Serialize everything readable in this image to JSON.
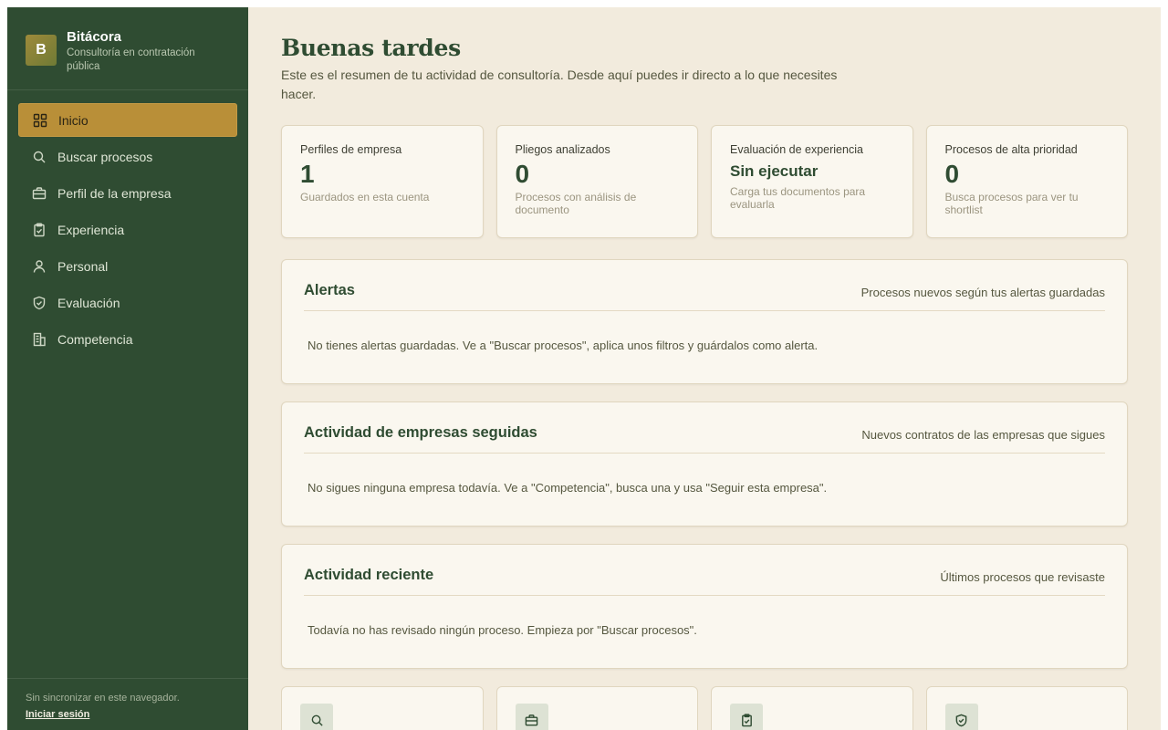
{
  "brand": {
    "initial": "B",
    "name": "Bitácora",
    "subtitle": "Consultoría en contratación pública"
  },
  "nav": {
    "items": [
      {
        "label": "Inicio",
        "icon": "grid-icon",
        "active": true
      },
      {
        "label": "Buscar procesos",
        "icon": "search-icon"
      },
      {
        "label": "Perfil de la empresa",
        "icon": "briefcase-icon"
      },
      {
        "label": "Experiencia",
        "icon": "clipboard-check-icon"
      },
      {
        "label": "Personal",
        "icon": "user-icon"
      },
      {
        "label": "Evaluación",
        "icon": "shield-check-icon"
      },
      {
        "label": "Competencia",
        "icon": "building-icon"
      }
    ]
  },
  "footer": {
    "sync_text": "Sin sincronizar en este navegador.",
    "login_label": "Iniciar sesión"
  },
  "header": {
    "greeting": "Buenas tardes",
    "intro": "Este es el resumen de tu actividad de consultoría. Desde aquí puedes ir directo a lo que necesites hacer."
  },
  "stats": [
    {
      "label": "Perfiles de empresa",
      "value": "1",
      "note": "Guardados en esta cuenta"
    },
    {
      "label": "Pliegos analizados",
      "value": "0",
      "note": "Procesos con análisis de documento"
    },
    {
      "label": "Evaluación de experiencia",
      "value": "Sin ejecutar",
      "note": "Carga tus documentos para evaluarla"
    },
    {
      "label": "Procesos de alta prioridad",
      "value": "0",
      "note": "Busca procesos para ver tu shortlist"
    }
  ],
  "panels": {
    "alerts": {
      "title": "Alertas",
      "subtitle": "Procesos nuevos según tus alertas guardadas",
      "body": "No tienes alertas guardadas. Ve a \"Buscar procesos\", aplica unos filtros y guárdalos como alerta."
    },
    "followed": {
      "title": "Actividad de empresas seguidas",
      "subtitle": "Nuevos contratos de las empresas que sigues",
      "body": "No sigues ninguna empresa todavía. Ve a \"Competencia\", busca una y usa \"Seguir esta empresa\"."
    },
    "recent": {
      "title": "Actividad reciente",
      "subtitle": "Últimos procesos que revisaste",
      "body": "Todavía no has revisado ningún proceso. Empieza por \"Buscar procesos\"."
    }
  },
  "quick_cards": [
    {
      "icon": "search-icon"
    },
    {
      "icon": "briefcase-icon"
    },
    {
      "icon": "clipboard-check-icon"
    },
    {
      "icon": "shield-check-icon"
    }
  ],
  "colors": {
    "sidebar": "#2f4c32",
    "accent": "#b98f38",
    "main_bg": "#f2ebdd",
    "card_bg": "#faf7ef"
  }
}
